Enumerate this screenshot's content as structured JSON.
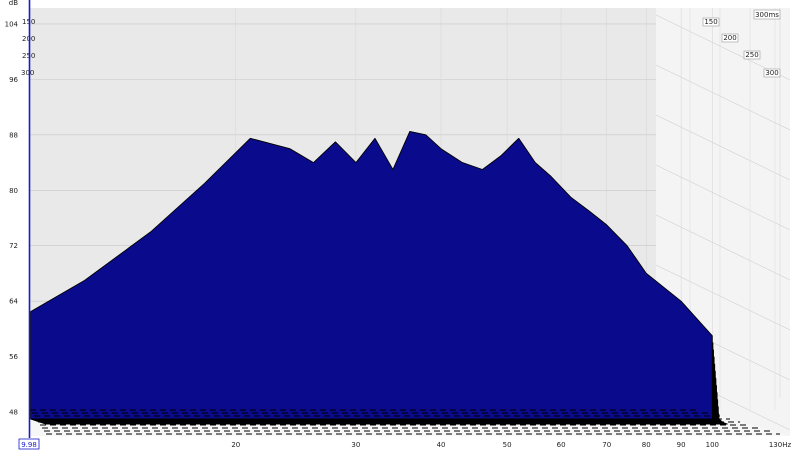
{
  "chart_data": {
    "type": "area",
    "chart_kind": "waterfall",
    "ylabel": "dB",
    "xunit": "Hz",
    "yticks": [
      104,
      96,
      88,
      80,
      72,
      64,
      56,
      48
    ],
    "xticks": [
      {
        "value": 20,
        "label": "20"
      },
      {
        "value": 30,
        "label": "30"
      },
      {
        "value": 40,
        "label": "40"
      },
      {
        "value": 50,
        "label": "50"
      },
      {
        "value": 60,
        "label": "60"
      },
      {
        "value": 70,
        "label": "70"
      },
      {
        "value": 80,
        "label": "80"
      },
      {
        "value": 90,
        "label": "90"
      },
      {
        "value": 100,
        "label": "100"
      },
      {
        "value": 130,
        "label": "130Hz"
      }
    ],
    "x_start_label": "9.98",
    "x_scale": "log",
    "xlim": [
      9.98,
      130
    ],
    "ylim": [
      47,
      105
    ],
    "time_ticks_right": [
      "150",
      "200",
      "250",
      "300"
    ],
    "time_ticks_left": [
      "150",
      "200",
      "250",
      "300"
    ],
    "time_unit_label": "300ms",
    "cursor_color": "#1a1acd",
    "fill_color": "#0a0a8c",
    "line_color": "#000000",
    "back_wall_color": "#e9e9e9",
    "front_slice": {
      "freq": [
        10,
        12,
        15,
        18,
        21,
        24,
        26,
        28,
        30,
        32,
        34,
        36,
        38,
        40,
        43,
        46,
        49,
        52,
        55,
        58,
        62,
        66,
        70,
        75,
        80,
        90,
        100
      ],
      "level_db": [
        62.5,
        67,
        74,
        81,
        87.5,
        86,
        84,
        87,
        84,
        87.5,
        83,
        88.5,
        88,
        86,
        84,
        83,
        85,
        87.5,
        84,
        82,
        79,
        77,
        75,
        72,
        68,
        64,
        59
      ]
    }
  }
}
